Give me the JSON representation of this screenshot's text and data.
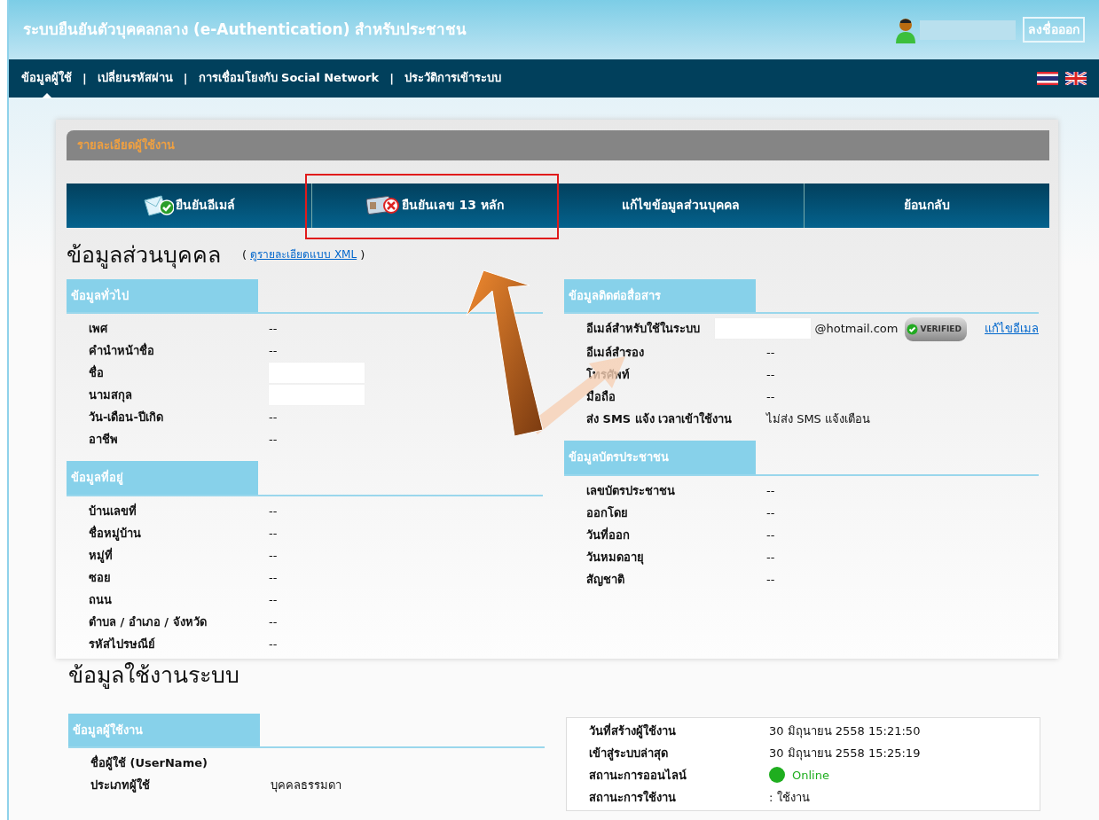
{
  "header": {
    "title": "ระบบยืนยันตัวบุคคลกลาง (e-Authentication) สำหรับประชาชน",
    "logout": "ลงชื่อออก"
  },
  "menu": [
    {
      "label": "ข้อมูลผู้ใช้",
      "selected": true
    },
    {
      "label": "เปลี่ยนรหัสผ่าน",
      "selected": false
    },
    {
      "label": "การเชื่อมโยงกับ Social Network",
      "selected": false
    },
    {
      "label": "ประวัติการเข้าระบบ",
      "selected": false
    }
  ],
  "menu_separators": [
    "|",
    "|",
    "|"
  ],
  "panel_title": "รายละเอียดผู้ใช้งาน",
  "actions": [
    {
      "label": "ยืนยันอีเมล์",
      "kind": "email-verified",
      "highlighted": false
    },
    {
      "label": "ยืนยันเลข 13 หลัก",
      "kind": "card-unverified",
      "highlighted": true
    },
    {
      "label": "แก้ไขข้อมูลส่วนบุคคล",
      "kind": "plain",
      "highlighted": false
    },
    {
      "label": "ย้อนกลับ",
      "kind": "plain",
      "highlighted": false
    }
  ],
  "personal": {
    "heading": "ข้อมูลส่วนบุคคล",
    "xml_open": "(",
    "xml_link": "ดูรายละเอียดแบบ XML",
    "xml_close": ")",
    "left": [
      {
        "title": "ข้อมูลทั่วไป",
        "rows": [
          {
            "label": "เพศ",
            "kind": "text",
            "value": "--"
          },
          {
            "label": "คำนำหน้าชื่อ",
            "kind": "text",
            "value": "--"
          },
          {
            "label": "ชื่อ",
            "kind": "redacted"
          },
          {
            "label": "นามสกุล",
            "kind": "redacted"
          },
          {
            "label": "วัน-เดือน-ปีเกิด",
            "kind": "text",
            "value": "--"
          },
          {
            "label": "อาชีพ",
            "kind": "text",
            "value": "--"
          }
        ]
      },
      {
        "title": "ข้อมูลที่อยู่",
        "rows": [
          {
            "label": "บ้านเลขที่",
            "kind": "text",
            "value": "--"
          },
          {
            "label": "ชื่อหมู่บ้าน",
            "kind": "text",
            "value": "--"
          },
          {
            "label": "หมู่ที่",
            "kind": "text",
            "value": "--"
          },
          {
            "label": "ซอย",
            "kind": "text",
            "value": "--"
          },
          {
            "label": "ถนน",
            "kind": "text",
            "value": "--"
          },
          {
            "label": "ตำบล / อำเภอ / จังหวัด",
            "kind": "text",
            "value": "--"
          },
          {
            "label": "รหัสไปรษณีย์",
            "kind": "text",
            "value": "--"
          }
        ]
      }
    ],
    "right": [
      {
        "title": "ข้อมูลติดต่อสื่อสาร",
        "rows": [
          {
            "label": "อีเมล์สำหรับใช้ในระบบ",
            "kind": "email",
            "value": "@hotmail.com",
            "badge": "VERIFIED",
            "link": "แก้ไขอีเมล"
          },
          {
            "label": "อีเมล์สำรอง",
            "kind": "text",
            "value": "--"
          },
          {
            "label": "โทรศัพท์",
            "kind": "text",
            "value": "--"
          },
          {
            "label": "มือถือ",
            "kind": "text",
            "value": "--"
          },
          {
            "label": "ส่ง SMS แจ้ง เวลาเข้าใช้งาน",
            "kind": "text",
            "value": "ไม่ส่ง SMS แจ้งเตือน"
          }
        ]
      },
      {
        "title": "ข้อมูลบัตรประชาชน",
        "rows": [
          {
            "label": "เลขบัตรประชาชน",
            "kind": "text",
            "value": "--"
          },
          {
            "label": "ออกโดย",
            "kind": "text",
            "value": "--"
          },
          {
            "label": "วันที่ออก",
            "kind": "text",
            "value": "--"
          },
          {
            "label": "วันหมดอายุ",
            "kind": "text",
            "value": "--"
          },
          {
            "label": "สัญชาติ",
            "kind": "text",
            "value": "--"
          }
        ]
      }
    ]
  },
  "system": {
    "heading": "ข้อมูลใช้งานระบบ",
    "left": [
      {
        "title": "ข้อมูลผู้ใช้งาน",
        "rows": [
          {
            "label": "ชื่อผู้ใช้ (UserName)",
            "kind": "empty"
          },
          {
            "label": "ประเภทผู้ใช้",
            "kind": "text",
            "value": "บุคคลธรรมดา"
          }
        ]
      }
    ],
    "stats": [
      {
        "label": "วันที่สร้างผู้ใช้งาน",
        "kind": "text",
        "value": "30 มิถุนายน 2558 15:21:50"
      },
      {
        "label": "เข้าสู่ระบบล่าสุด",
        "kind": "text",
        "value": "30 มิถุนายน 2558 15:25:19"
      },
      {
        "label": "สถานะการออนไลน์",
        "kind": "status",
        "value": "Online",
        "color": "#1fae1f"
      },
      {
        "label": "สถานะการใช้งาน",
        "kind": "text",
        "value": ": ใช้งาน"
      }
    ]
  }
}
